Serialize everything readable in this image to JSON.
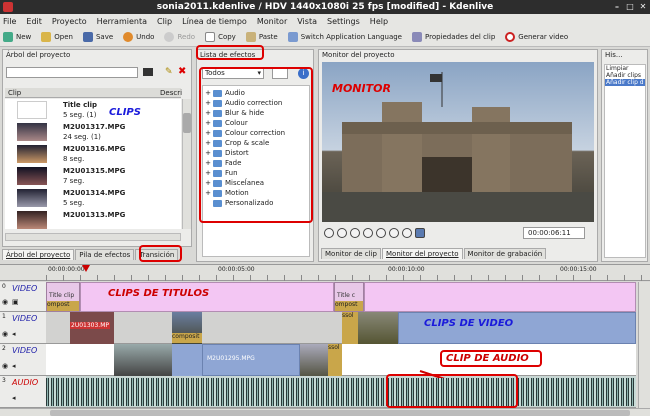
{
  "window": {
    "title": "sonia2011.kdenlive / HDV 1440x1080i 25 fps [modified] - Kdenlive"
  },
  "menu": [
    "File",
    "Edit",
    "Proyecto",
    "Herramienta",
    "Clip",
    "Línea de tiempo",
    "Monitor",
    "Vista",
    "Settings",
    "Help"
  ],
  "toolbar": {
    "new": "New",
    "open": "Open",
    "save": "Save",
    "undo": "Undo",
    "redo": "Redo",
    "copy": "Copy",
    "paste": "Paste",
    "switch": "Switch Application Language",
    "props": "Propiedades del clip",
    "render": "Generar video"
  },
  "project_panel": {
    "title": "Árbol del proyecto",
    "col_clip": "Clip",
    "col_desc": "Descri",
    "clips": [
      {
        "name": "Title clip",
        "info": "5 seg. (1)"
      },
      {
        "name": "M2U01317.MPG",
        "info": "24 seg. (1)"
      },
      {
        "name": "M2U01316.MPG",
        "info": "8 seg."
      },
      {
        "name": "M2U01315.MPG",
        "info": "7 seg."
      },
      {
        "name": "M2U01314.MPG",
        "info": "5 seg."
      },
      {
        "name": "M2U01313.MPG",
        "info": ""
      }
    ]
  },
  "effects_panel": {
    "title": "Lista de efectos",
    "filter": "Todos",
    "items": [
      "Audio",
      "Audio correction",
      "Blur & hide",
      "Colour",
      "Colour correction",
      "Crop & scale",
      "Distort",
      "Fade",
      "Fun",
      "Misceĺanea",
      "Motion",
      "Personalizado"
    ]
  },
  "monitor": {
    "title": "Monitor del proyecto",
    "timecode": "00:00:06:11",
    "tabs": [
      "Monitor de clip",
      "Monitor del proyecto",
      "Monitor de grabación"
    ]
  },
  "history": {
    "title": "His...",
    "items": [
      "Limpiar",
      "Añadir clips",
      "Añadir clip d"
    ]
  },
  "left_tabs": [
    "Árbol del proyecto",
    "Pila de efectos",
    "Transición"
  ],
  "ruler": [
    "00:00:00:00",
    "00:00:05:00",
    "00:00:10:00",
    "00:00:15:00"
  ],
  "tracks": [
    {
      "num": "0",
      "label": "VIDEO"
    },
    {
      "num": "1",
      "label": "VIDEO"
    },
    {
      "num": "2",
      "label": "VIDEO"
    },
    {
      "num": "3",
      "label": "AUDIO"
    }
  ],
  "timeline_clips": {
    "title1": "Title clip",
    "title2": "Title c",
    "comp1": "ompost",
    "comp2": "ompost",
    "comp3": "composit",
    "comp4": "ssol",
    "m1313": "2U01303.MP",
    "m1295": "M2U01295.MPG",
    "comp5": "ssol"
  },
  "annotations": {
    "clips": "CLIPS",
    "monitor": "MONITOR",
    "titulos": "CLIPS DE TITULOS",
    "video": "CLIPS DE VIDEO",
    "audio": "CLIP DE AUDIO"
  }
}
